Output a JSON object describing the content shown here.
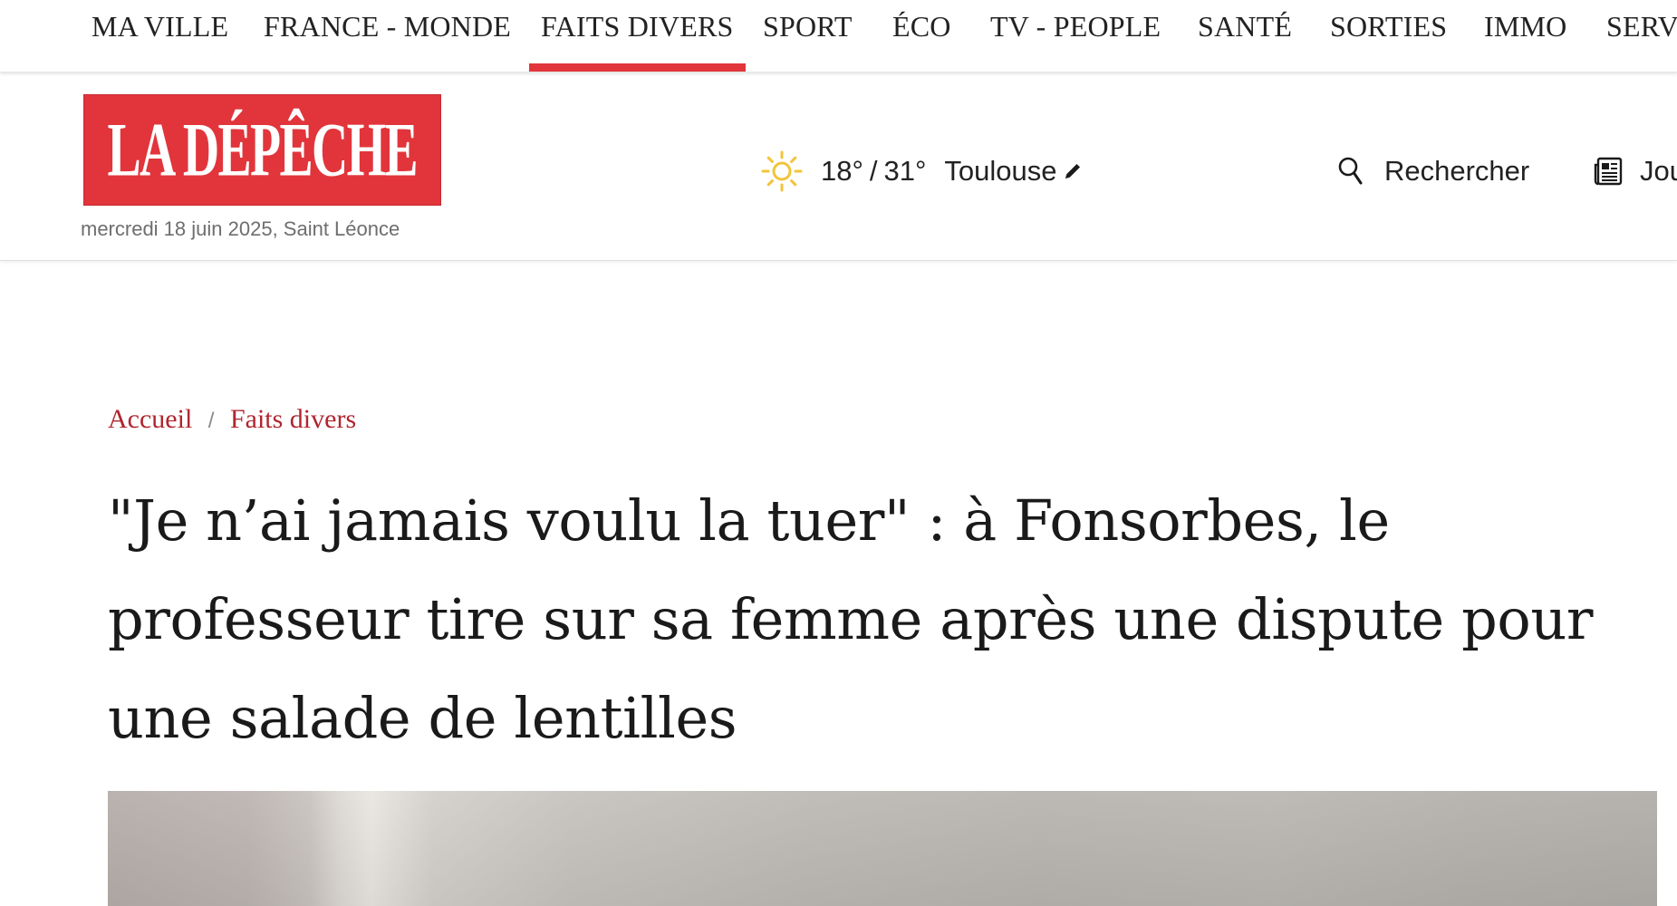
{
  "nav": {
    "items": [
      {
        "label": "MA VILLE"
      },
      {
        "label": "FRANCE - MONDE"
      },
      {
        "label": "FAITS DIVERS"
      },
      {
        "label": "SPORT"
      },
      {
        "label": "ÉCO"
      },
      {
        "label": "TV - PEOPLE"
      },
      {
        "label": "SANTÉ"
      },
      {
        "label": "SORTIES"
      },
      {
        "label": "IMMO"
      },
      {
        "label": "SERV"
      }
    ],
    "active_item": "FAITS DIVERS",
    "accent_color": "#e1353b"
  },
  "header": {
    "logo_text": "LA DÉPÊCHE",
    "date_line": "mercredi 18 juin 2025, Saint Léonce",
    "weather": {
      "icon": "sun-icon",
      "temp_min": "18°",
      "separator": "/",
      "temp_max": "31°",
      "city": "Toulouse",
      "edit_icon": "pencil-icon"
    },
    "search": {
      "icon": "search-icon",
      "label": "Rechercher"
    },
    "journal": {
      "icon": "newspaper-icon",
      "label": "Jou"
    }
  },
  "breadcrumb": {
    "items": [
      "Accueil",
      "Faits divers"
    ],
    "separator": "/",
    "color": "#b0252f"
  },
  "article": {
    "headline": "\"Je n’ai jamais voulu la tuer\" : à Fonsorbes, le professeur tire sur sa femme après une dispute pour une salade de lentilles"
  }
}
